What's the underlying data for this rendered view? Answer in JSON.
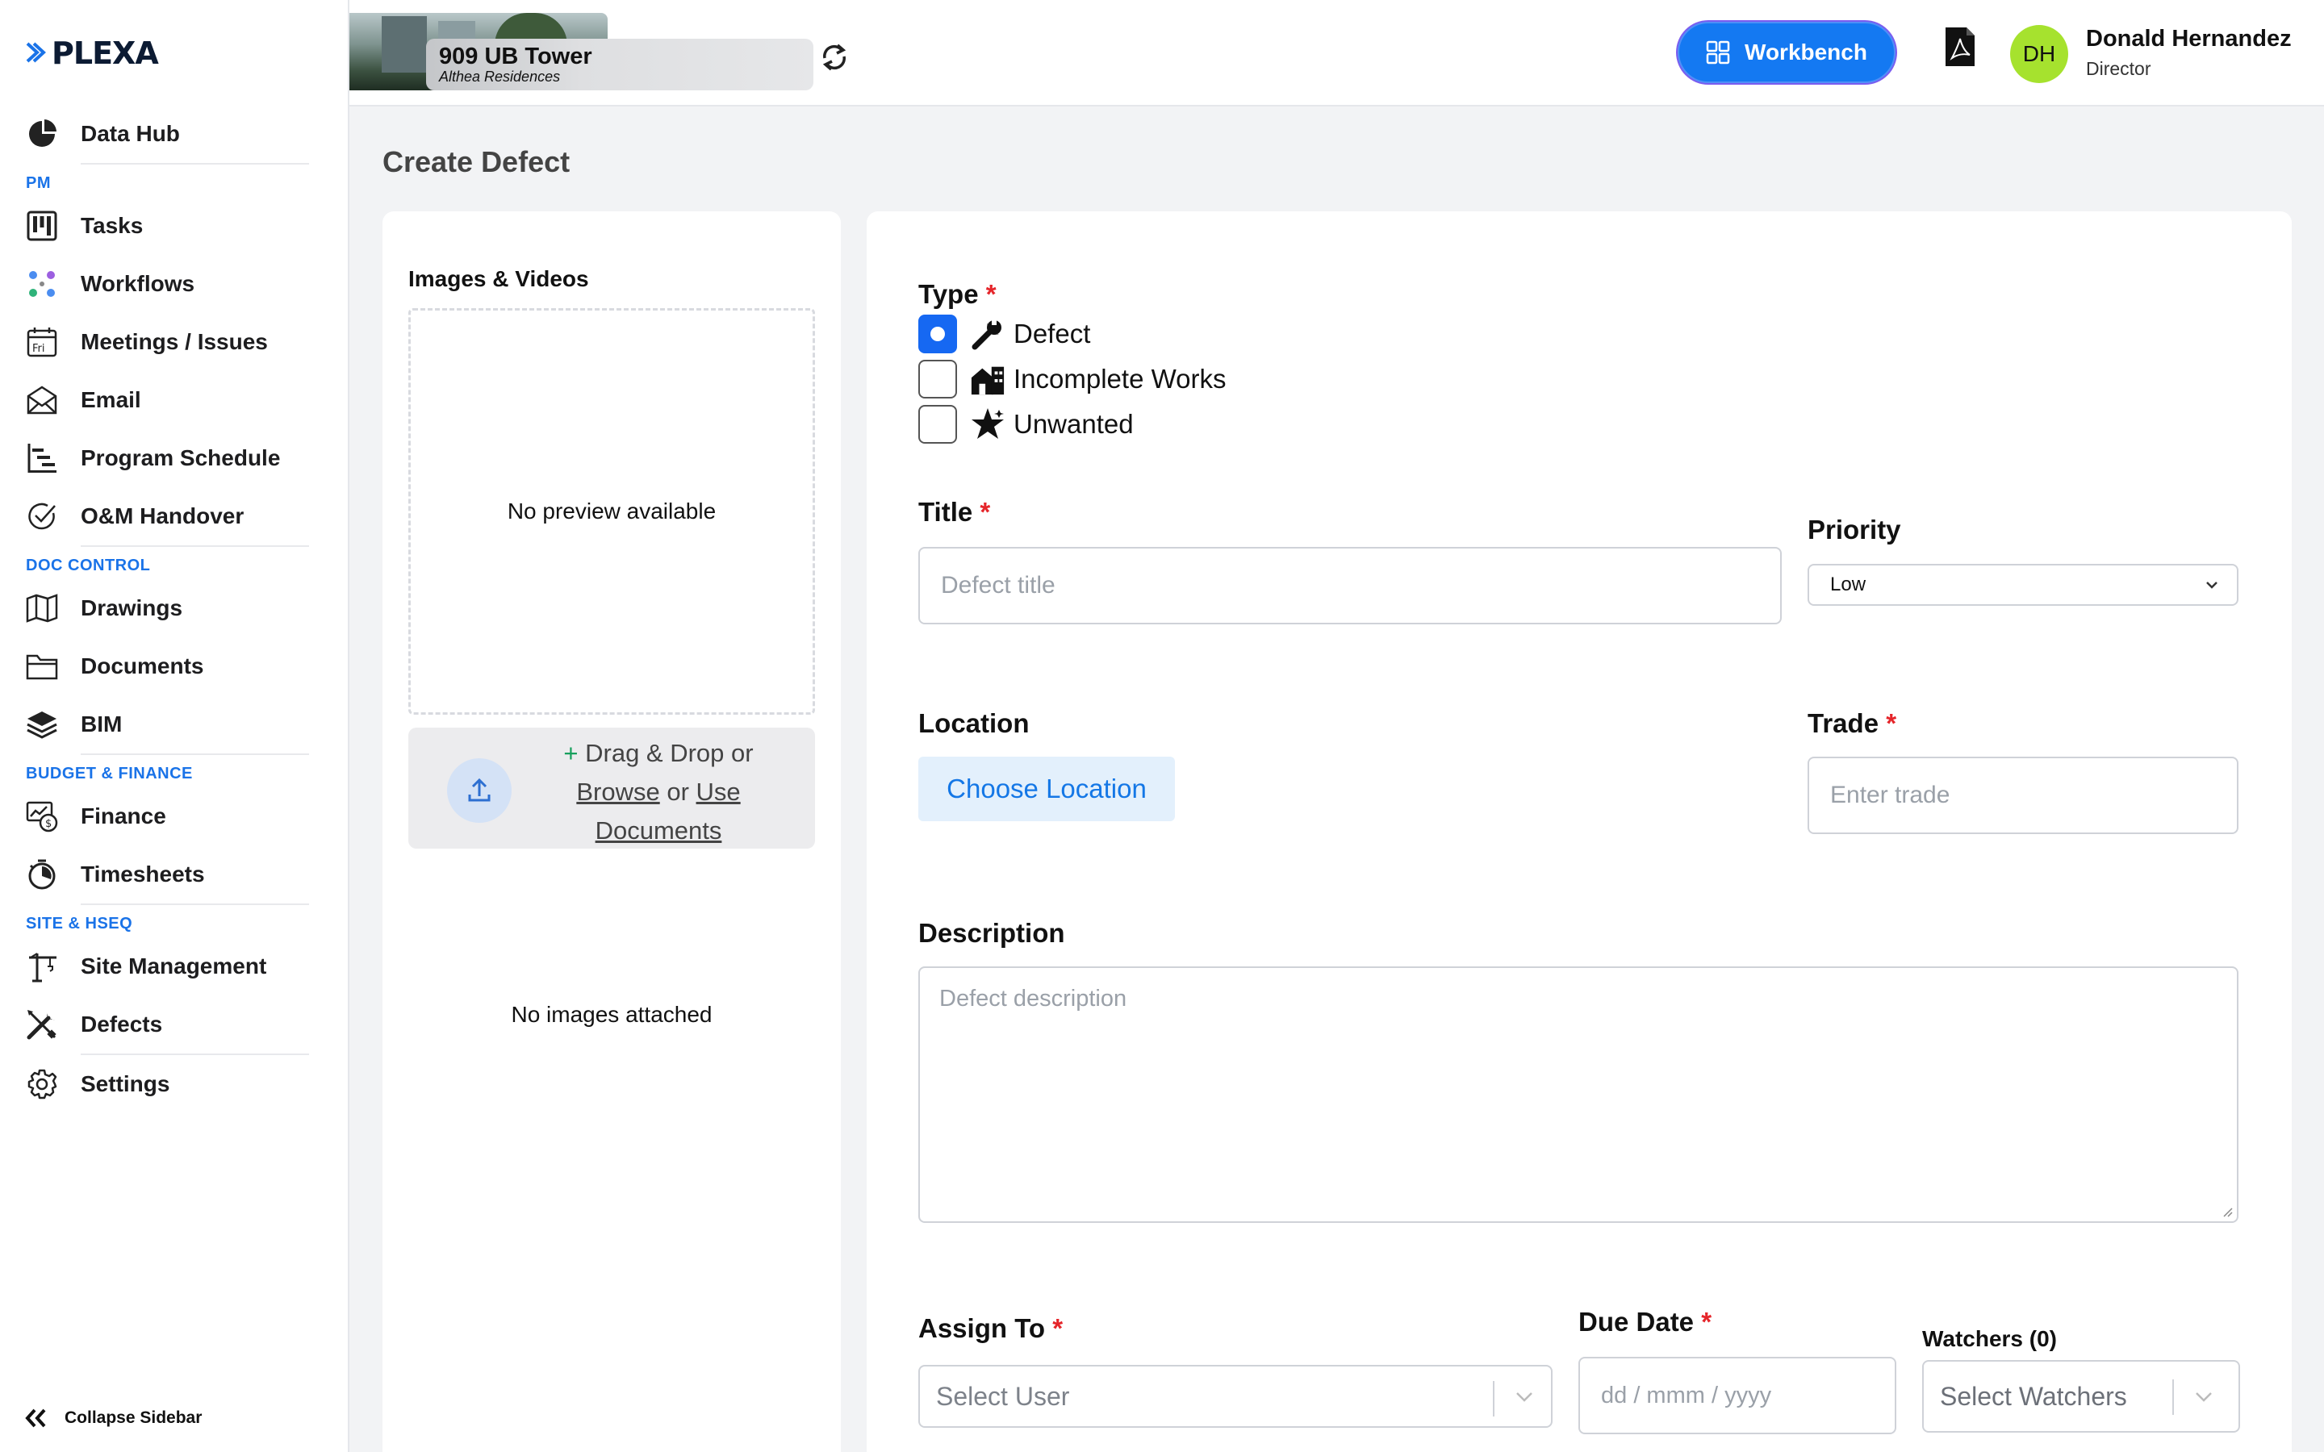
{
  "brand": {
    "logo_text": "PLEXA"
  },
  "sidebar": {
    "items": [
      {
        "label": "Data Hub"
      },
      {
        "section": "PM"
      },
      {
        "label": "Tasks"
      },
      {
        "label": "Workflows"
      },
      {
        "label": "Meetings / Issues"
      },
      {
        "label": "Email"
      },
      {
        "label": "Program Schedule"
      },
      {
        "label": "O&M Handover"
      },
      {
        "section": "DOC CONTROL"
      },
      {
        "label": "Drawings"
      },
      {
        "label": "Documents"
      },
      {
        "label": "BIM"
      },
      {
        "section": "BUDGET & FINANCE"
      },
      {
        "label": "Finance"
      },
      {
        "label": "Timesheets"
      },
      {
        "section": "SITE & HSEQ"
      },
      {
        "label": "Site Management"
      },
      {
        "label": "Defects"
      },
      {
        "label": "Settings"
      }
    ],
    "collapse_label": "Collapse Sidebar"
  },
  "header": {
    "project_name": "909 UB Tower",
    "project_sub": "Althea Residences",
    "workbench_label": "Workbench",
    "user_initials": "DH",
    "user_name": "Donald Hernandez",
    "user_role": "Director"
  },
  "page": {
    "title": "Create Defect"
  },
  "media": {
    "label": "Images & Videos",
    "no_preview": "No preview available",
    "drop_plus": "+",
    "drop_text": "Drag & Drop or",
    "browse": "Browse",
    "or": "or",
    "use": "Use",
    "documents": "Documents",
    "no_images": "No images attached"
  },
  "form": {
    "type_label": "Type",
    "required_mark": "*",
    "type_options": [
      "Defect",
      "Incomplete Works",
      "Unwanted"
    ],
    "type_selected": "Defect",
    "title_label": "Title",
    "title_placeholder": "Defect title",
    "priority_label": "Priority",
    "priority_value": "Low",
    "location_label": "Location",
    "choose_location": "Choose Location",
    "trade_label": "Trade",
    "trade_placeholder": "Enter trade",
    "description_label": "Description",
    "description_placeholder": "Defect description",
    "assign_label": "Assign To",
    "assign_placeholder": "Select User",
    "due_label": "Due Date",
    "due_placeholder": "dd / mmm / yyyy",
    "watchers_label": "Watchers (0)",
    "watchers_placeholder": "Select Watchers"
  },
  "colors": {
    "accent": "#1479f2",
    "required": "#e5252a",
    "avatar": "#a6e22e",
    "section": "#1a73e8"
  }
}
